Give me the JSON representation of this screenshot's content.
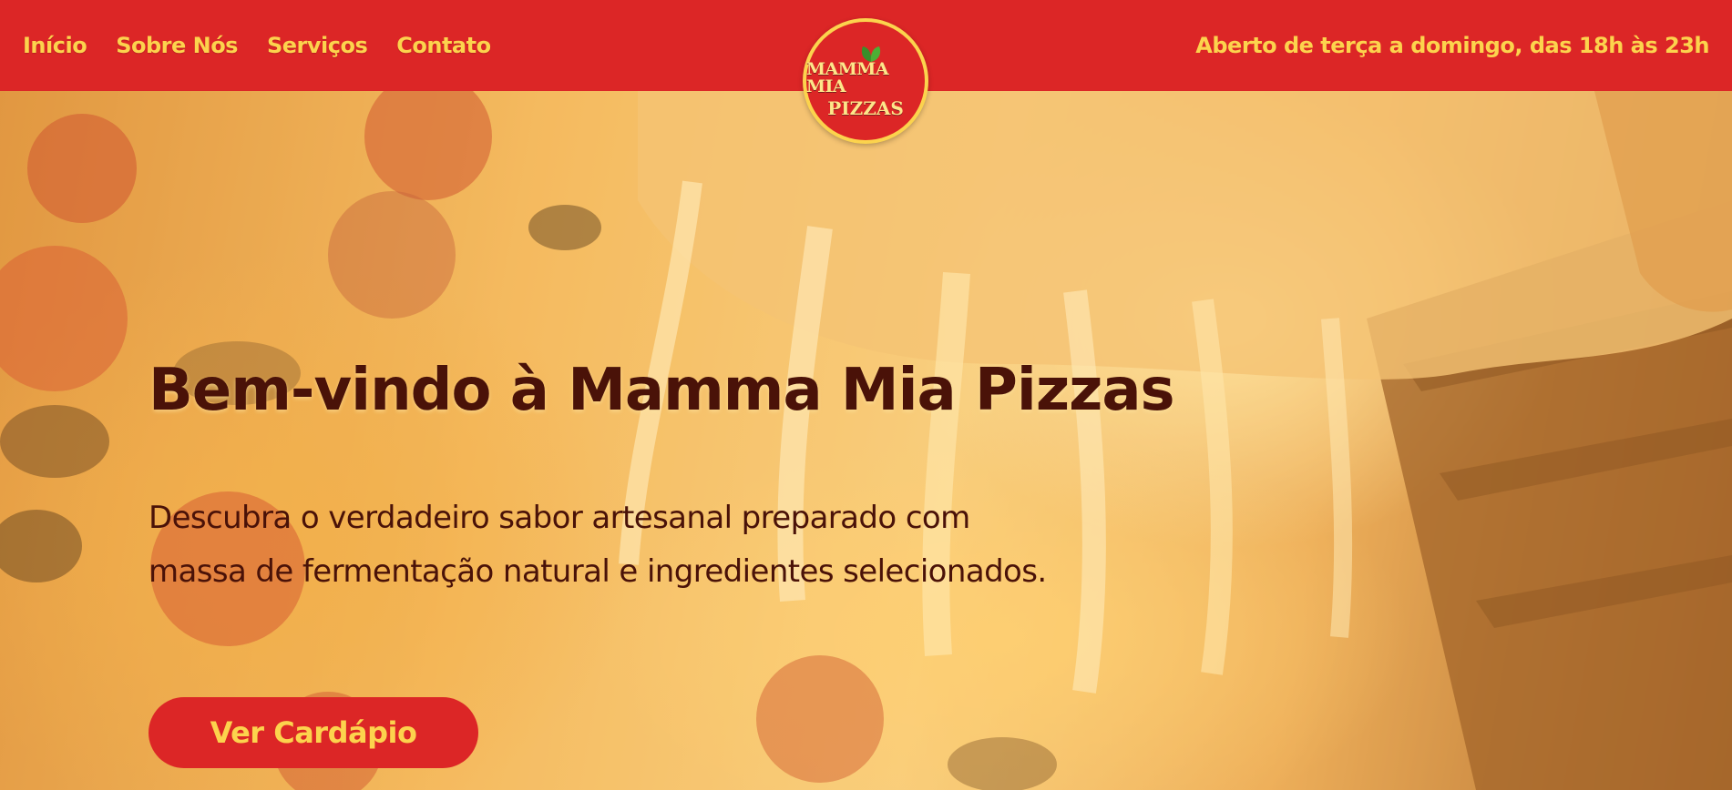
{
  "nav": {
    "items": [
      {
        "label": "Início"
      },
      {
        "label": "Sobre Nós"
      },
      {
        "label": "Serviços"
      },
      {
        "label": "Contato"
      }
    ]
  },
  "logo": {
    "line1": "MAMMA MIA",
    "line2": "PIZZAS"
  },
  "header": {
    "hours": "Aberto de terça a domingo, das 18h às 23h"
  },
  "hero": {
    "title": "Bem-vindo à Mamma Mia Pizzas",
    "description": "Descubra o verdadeiro sabor artesanal preparado com massa de fermentação natural e ingredientes selecionados.",
    "cta_label": "Ver Cardápio"
  },
  "colors": {
    "header_bg": "#dc2626",
    "nav_text": "#fcd34d",
    "hero_text": "#4a1208",
    "button_bg": "#dc2626",
    "button_text": "#fcd34d"
  },
  "icons": {
    "logo_leaf": "basil-leaf-icon"
  }
}
